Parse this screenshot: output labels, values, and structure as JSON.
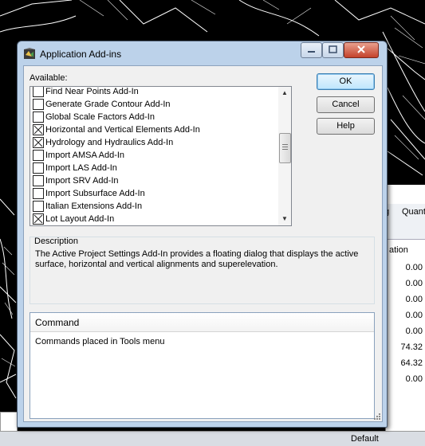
{
  "background": {
    "panel_header_1": "g",
    "panel_header_2": "Quant",
    "panel_subheader": "ation",
    "values": [
      "0.00",
      "0.00",
      "0.00",
      "0.00",
      "0.00",
      "74.32",
      "64.32",
      "0.00"
    ],
    "bottom_status": "Default"
  },
  "dialog": {
    "title": "Application Add-ins",
    "available_label": "Available:",
    "items": [
      {
        "label": "Find Near Points Add-In",
        "checked": false
      },
      {
        "label": "Generate Grade Contour Add-In",
        "checked": false
      },
      {
        "label": "Global Scale Factors Add-In",
        "checked": false
      },
      {
        "label": "Horizontal and Vertical Elements Add-In",
        "checked": true
      },
      {
        "label": "Hydrology and Hydraulics Add-In",
        "checked": true
      },
      {
        "label": "Import AMSA Add-In",
        "checked": false
      },
      {
        "label": "Import LAS Add-In",
        "checked": false
      },
      {
        "label": "Import SRV Add-In",
        "checked": false
      },
      {
        "label": "Import Subsurface Add-In",
        "checked": false
      },
      {
        "label": "Italian Extensions Add-In",
        "checked": false
      },
      {
        "label": "Lot Layout Add-In",
        "checked": true
      }
    ],
    "buttons": {
      "ok": "OK",
      "cancel": "Cancel",
      "help": "Help"
    },
    "description": {
      "title": "Description",
      "text": "The Active Project Settings Add-In provides a floating dialog that displays the active surface, horizontal and vertical alignments and superelevation."
    },
    "command": {
      "header": "Command",
      "text": "Commands placed in Tools menu"
    }
  },
  "colors": {
    "frame": "#bcd2ea",
    "client": "#f0f0f0",
    "default_button": "#3c7fb1"
  }
}
